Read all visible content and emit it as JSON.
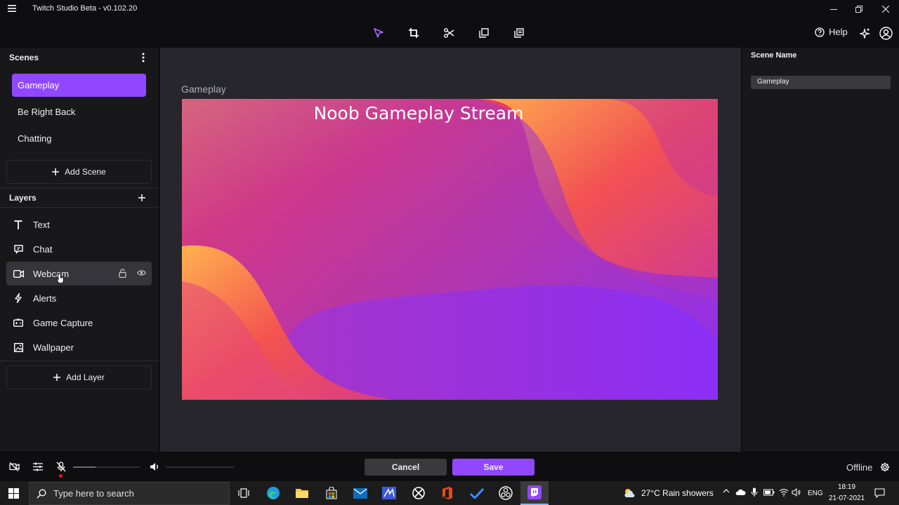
{
  "window": {
    "title": "Twitch Studio Beta - v0.102.20"
  },
  "toolbar": {
    "help_label": "Help"
  },
  "scenes": {
    "header": "Scenes",
    "items": [
      {
        "label": "Gameplay"
      },
      {
        "label": "Be Right Back"
      },
      {
        "label": "Chatting"
      }
    ],
    "add_label": "Add Scene"
  },
  "layers": {
    "header": "Layers",
    "items": [
      {
        "label": "Text",
        "icon": "text-icon"
      },
      {
        "label": "Chat",
        "icon": "chat-icon"
      },
      {
        "label": "Webcam",
        "icon": "webcam-icon"
      },
      {
        "label": "Alerts",
        "icon": "alerts-icon"
      },
      {
        "label": "Game Capture",
        "icon": "game-capture-icon"
      },
      {
        "label": "Wallpaper",
        "icon": "wallpaper-icon"
      }
    ],
    "add_label": "Add Layer"
  },
  "canvas": {
    "scene_title": "Gameplay",
    "stream_title": "Noob Gameplay Stream"
  },
  "properties": {
    "header": "Scene Name",
    "scene_name_value": "Gameplay"
  },
  "footer": {
    "cancel_label": "Cancel",
    "save_label": "Save",
    "status": "Offline"
  },
  "taskbar": {
    "search_placeholder": "Type here to search",
    "weather": "27°C  Rain showers",
    "language": "ENG",
    "time": "18:19",
    "date": "21-07-2021"
  },
  "colors": {
    "accent": "#9147ff",
    "panel": "#18181b",
    "canvas_bg": "#26262c"
  }
}
